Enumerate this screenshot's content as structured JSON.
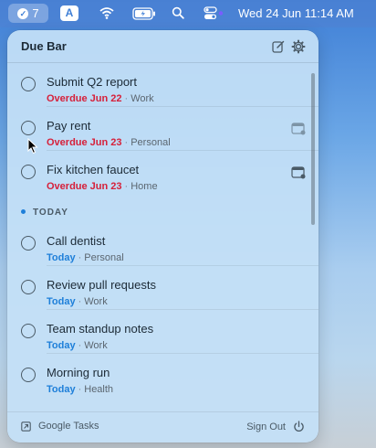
{
  "menubar": {
    "badge_count": "7",
    "input_source": "A",
    "datetime": "Wed 24 Jun  11:14 AM",
    "icons": [
      "checkmark-circle-icon",
      "wifi-icon",
      "battery-icon",
      "search-icon",
      "control-center-icon"
    ]
  },
  "panel": {
    "title": "Due Bar",
    "compose_icon": "compose-icon",
    "settings_icon": "gear-icon"
  },
  "tasks": [
    {
      "title": "Submit Q2 report",
      "due": "Overdue Jun 22",
      "due_state": "overdue",
      "list": "Work",
      "has_calendar": false
    },
    {
      "title": "Pay rent",
      "due": "Overdue Jun 23",
      "due_state": "overdue",
      "list": "Personal",
      "has_calendar": true
    },
    {
      "title": "Fix kitchen faucet",
      "due": "Overdue Jun 23",
      "due_state": "overdue",
      "list": "Home",
      "has_calendar": true
    }
  ],
  "today_section": {
    "label": "TODAY",
    "tasks": [
      {
        "title": "Call dentist",
        "due": "Today",
        "due_state": "today",
        "list": "Personal"
      },
      {
        "title": "Review pull requests",
        "due": "Today",
        "due_state": "today",
        "list": "Work"
      },
      {
        "title": "Team standup notes",
        "due": "Today",
        "due_state": "today",
        "list": "Work"
      },
      {
        "title": "Morning run",
        "due": "Today",
        "due_state": "today",
        "list": "Health"
      }
    ]
  },
  "footer": {
    "source_label": "Google Tasks",
    "sign_out_label": "Sign Out"
  },
  "separator": "·",
  "colors": {
    "overdue": "#d6203a",
    "today": "#1e7fd9",
    "panel_bg": "#c4e0f6"
  }
}
